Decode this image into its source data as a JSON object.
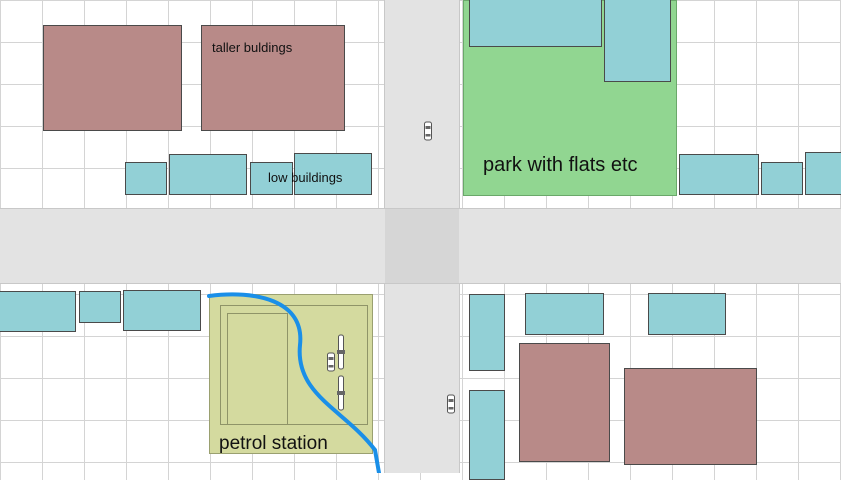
{
  "labels": {
    "taller_buildings": "taller buldings",
    "low_buildings": "low buildings",
    "park": "park with flats etc",
    "petrol_station": "petrol station"
  },
  "colors": {
    "low_building": "#92d0d6",
    "tall_building": "#b88a88",
    "park": "#91d691",
    "petrol_station": "#d4da9f",
    "road": "#e3e3e3",
    "route": "#1a8fe8"
  },
  "icons": [
    "car-icon",
    "route-line"
  ]
}
